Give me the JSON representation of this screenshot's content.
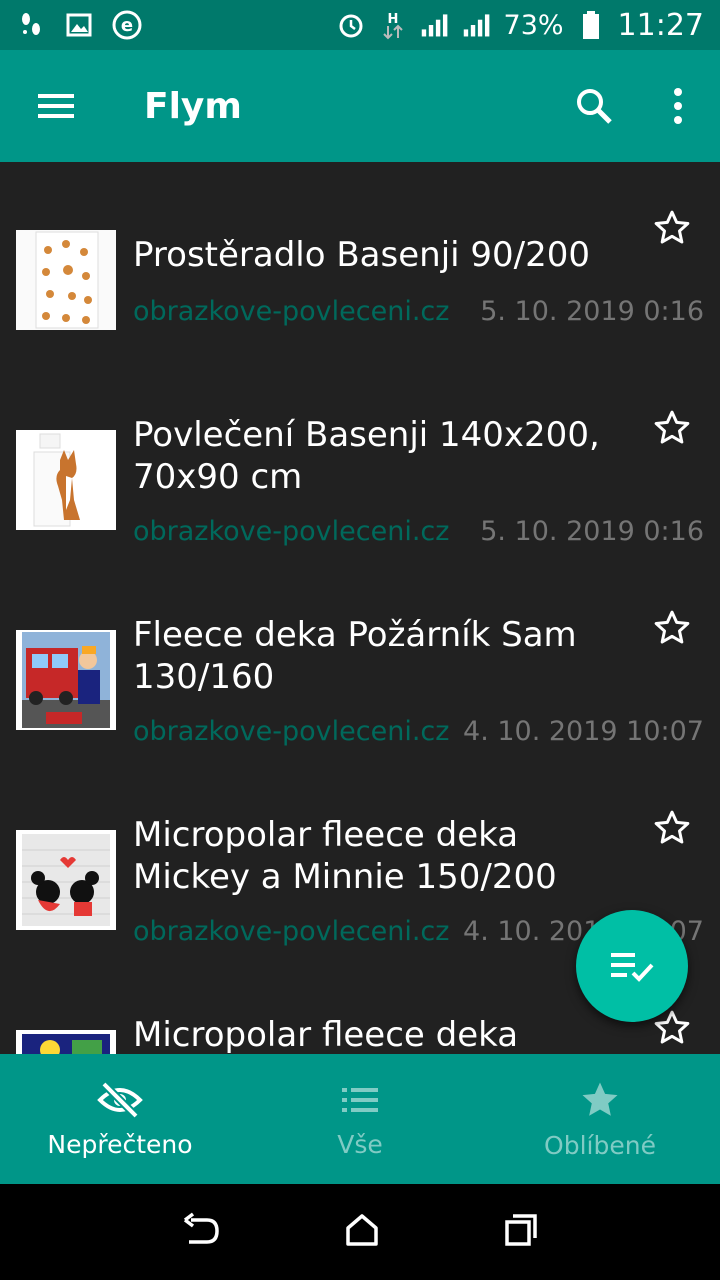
{
  "status_bar": {
    "battery": "73%",
    "time": "11:27",
    "icons": [
      "footsteps-icon",
      "image-icon",
      "e-icon",
      "alarm-icon",
      "hspa-icon",
      "signal-icon",
      "signal-2-icon",
      "battery-icon"
    ]
  },
  "toolbar": {
    "title": "Flym",
    "icons": [
      "menu-icon",
      "search-icon",
      "more-vert-icon"
    ]
  },
  "articles": [
    {
      "title": "Prostěradlo Basenji 90/200",
      "source": "obrazkove-povleceni.cz",
      "date": "5. 10. 2019 0:16",
      "thumb": "basenji-pattern"
    },
    {
      "title": "Povlečení Basenji 140x200, 70x90 cm",
      "source": "obrazkove-povleceni.cz",
      "date": "5. 10. 2019 0:16",
      "thumb": "basenji-dog"
    },
    {
      "title": "Fleece deka Požárník Sam 130/160",
      "source": "obrazkove-povleceni.cz",
      "date": "4. 10. 2019 10:07",
      "thumb": "fireman-sam"
    },
    {
      "title": "Micropolar fleece deka Mickey a Minnie 150/200",
      "source": "obrazkove-povleceni.cz",
      "date": "4. 10. 2019 10:07",
      "thumb": "mickey-minnie"
    },
    {
      "title": "Micropolar fleece deka",
      "source": "",
      "date": "",
      "thumb": "partial"
    }
  ],
  "fab": {
    "icon": "mark-all-read-icon",
    "color": "#00BFA5"
  },
  "bottom_nav": {
    "items": [
      {
        "label": "Nepřečteno",
        "icon": "eye-off-icon",
        "active": true
      },
      {
        "label": "Vše",
        "icon": "list-icon",
        "active": false
      },
      {
        "label": "Oblíbené",
        "icon": "star-icon",
        "active": false
      }
    ]
  },
  "colors": {
    "primary": "#009688",
    "primary_dark": "#00796B",
    "background": "#212121",
    "source_text": "#00695C",
    "accent": "#00BFA5"
  }
}
